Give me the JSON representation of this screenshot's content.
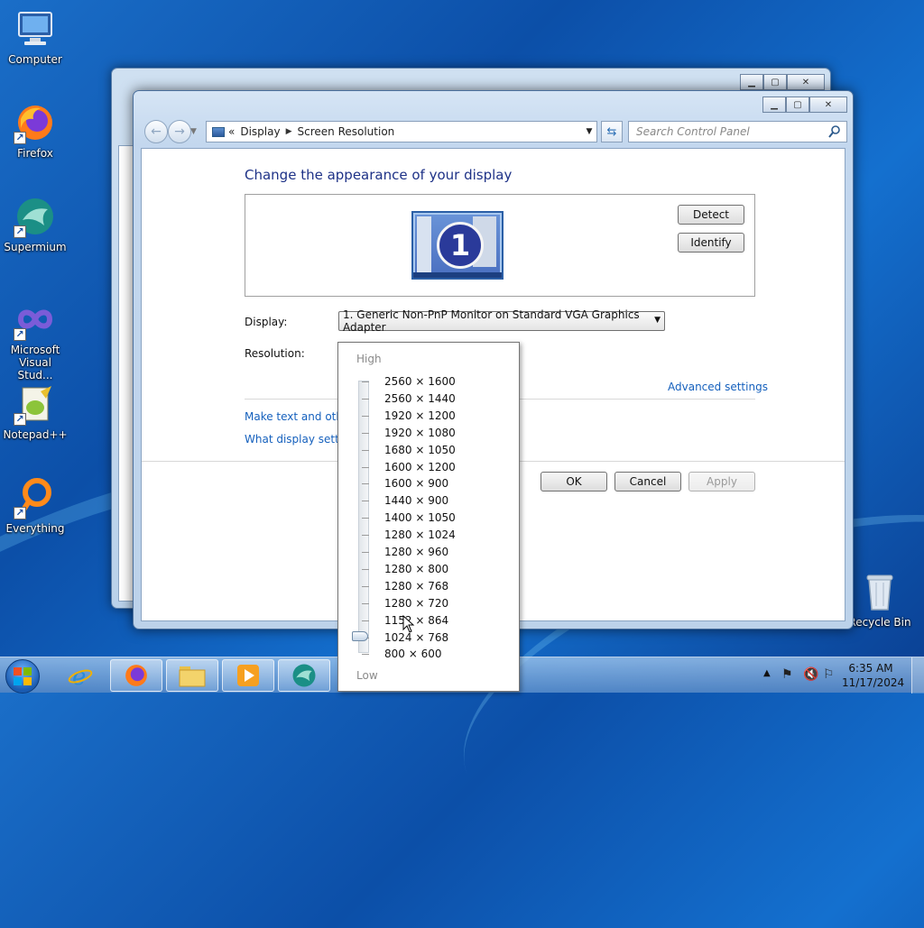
{
  "desktop": {
    "icons": [
      {
        "label": "Computer"
      },
      {
        "label": "Firefox"
      },
      {
        "label": "Supermium"
      },
      {
        "label": "Microsoft Visual Stud..."
      },
      {
        "label": "Notepad++"
      },
      {
        "label": "Everything"
      },
      {
        "label": "Recycle Bin"
      }
    ]
  },
  "window": {
    "breadcrumb": [
      "Display",
      "Screen Resolution"
    ],
    "breadcrumb_prefix": "«",
    "search_placeholder": "Search Control Panel",
    "title": "Change the appearance of your display",
    "monitor_number": "1",
    "detect_label": "Detect",
    "identify_label": "Identify",
    "display_label": "Display:",
    "display_value": "1. Generic Non-PnP Monitor on Standard VGA Graphics Adapter",
    "resolution_label": "Resolution:",
    "advanced_link": "Advanced settings",
    "link_text_size": "Make text and other",
    "link_what_settings": "What display setting",
    "ok_label": "OK",
    "cancel_label": "Cancel",
    "apply_label": "Apply"
  },
  "resolution_dropdown": {
    "high_label": "High",
    "low_label": "Low",
    "options": [
      "2560 × 1600",
      "2560 × 1440",
      "1920 × 1200",
      "1920 × 1080",
      "1680 × 1050",
      "1600 × 1200",
      "1600 × 900",
      "1440 × 900",
      "1400 × 1050",
      "1280 × 1024",
      "1280 × 960",
      "1280 × 800",
      "1280 × 768",
      "1280 × 720",
      "1152 × 864",
      "1024 × 768",
      "800 × 600"
    ],
    "selected": "1024 × 768"
  },
  "taskbar": {
    "time": "6:35 AM",
    "date": "11/17/2024"
  },
  "colors": {
    "link": "#1560bd",
    "title": "#1e3287",
    "desktop": "#1465c4"
  }
}
